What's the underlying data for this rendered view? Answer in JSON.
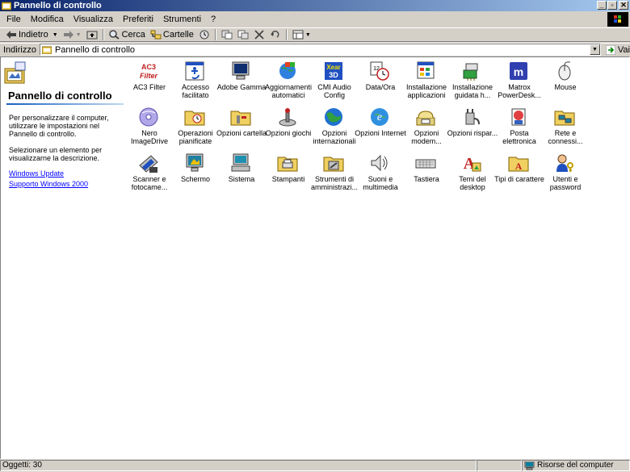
{
  "window": {
    "title": "Pannello di controllo"
  },
  "menu": [
    "File",
    "Modifica",
    "Visualizza",
    "Preferiti",
    "Strumenti",
    "?"
  ],
  "toolbar": {
    "back": "Indietro",
    "search": "Cerca",
    "folders": "Cartelle"
  },
  "address": {
    "label": "Indirizzo",
    "value": "Pannello di controllo",
    "go": "Vai"
  },
  "leftpane": {
    "title": "Pannello di controllo",
    "desc1": "Per personalizzare il computer, utilizzare le impostazioni nel Pannello di controllo.",
    "desc2": "Selezionare un elemento per visualizzarne la descrizione.",
    "link1": "Windows Update",
    "link2": "Supporto Windows 2000"
  },
  "icons": [
    {
      "label": "AC3 Filter",
      "icon": "ac3-filter-icon"
    },
    {
      "label": "Accesso facilitato",
      "icon": "accessibility-icon"
    },
    {
      "label": "Adobe Gamma",
      "icon": "monitor-icon"
    },
    {
      "label": "Aggiornamenti automatici",
      "icon": "globe-update-icon"
    },
    {
      "label": "CMI Audio Config",
      "icon": "audio-3d-icon"
    },
    {
      "label": "Data/Ora",
      "icon": "calendar-clock-icon"
    },
    {
      "label": "Installazione applicazioni",
      "icon": "install-apps-icon"
    },
    {
      "label": "Installazione guidata h...",
      "icon": "hardware-wizard-icon"
    },
    {
      "label": "Matrox PowerDesk...",
      "icon": "matrox-icon"
    },
    {
      "label": "Mouse",
      "icon": "mouse-icon"
    },
    {
      "label": "Nero ImageDrive",
      "icon": "nero-disc-icon"
    },
    {
      "label": "Operazioni pianificate",
      "icon": "scheduled-tasks-icon"
    },
    {
      "label": "Opzioni cartella",
      "icon": "folder-options-icon"
    },
    {
      "label": "Opzioni giochi",
      "icon": "joystick-icon"
    },
    {
      "label": "Opzioni internazionali",
      "icon": "globe-icon"
    },
    {
      "label": "Opzioni Internet",
      "icon": "internet-globe-icon"
    },
    {
      "label": "Opzioni modem...",
      "icon": "modem-phone-icon"
    },
    {
      "label": "Opzioni rispar...",
      "icon": "power-plug-icon"
    },
    {
      "label": "Posta elettronica",
      "icon": "mail-icon"
    },
    {
      "label": "Rete e connessi...",
      "icon": "network-icon"
    },
    {
      "label": "Scanner e fotocame...",
      "icon": "scanner-icon"
    },
    {
      "label": "Schermo",
      "icon": "display-icon"
    },
    {
      "label": "Sistema",
      "icon": "computer-icon"
    },
    {
      "label": "Stampanti",
      "icon": "printer-folder-icon"
    },
    {
      "label": "Strumenti di amministrazi...",
      "icon": "admin-tools-icon"
    },
    {
      "label": "Suoni e multimedia",
      "icon": "speaker-icon"
    },
    {
      "label": "Tastiera",
      "icon": "keyboard-icon"
    },
    {
      "label": "Temi del desktop",
      "icon": "themes-icon"
    },
    {
      "label": "Tipi di carattere",
      "icon": "fonts-folder-icon"
    },
    {
      "label": "Utenti e password",
      "icon": "users-keys-icon"
    }
  ],
  "status": {
    "objects": "Oggetti: 30",
    "zone": "Risorse del computer"
  }
}
